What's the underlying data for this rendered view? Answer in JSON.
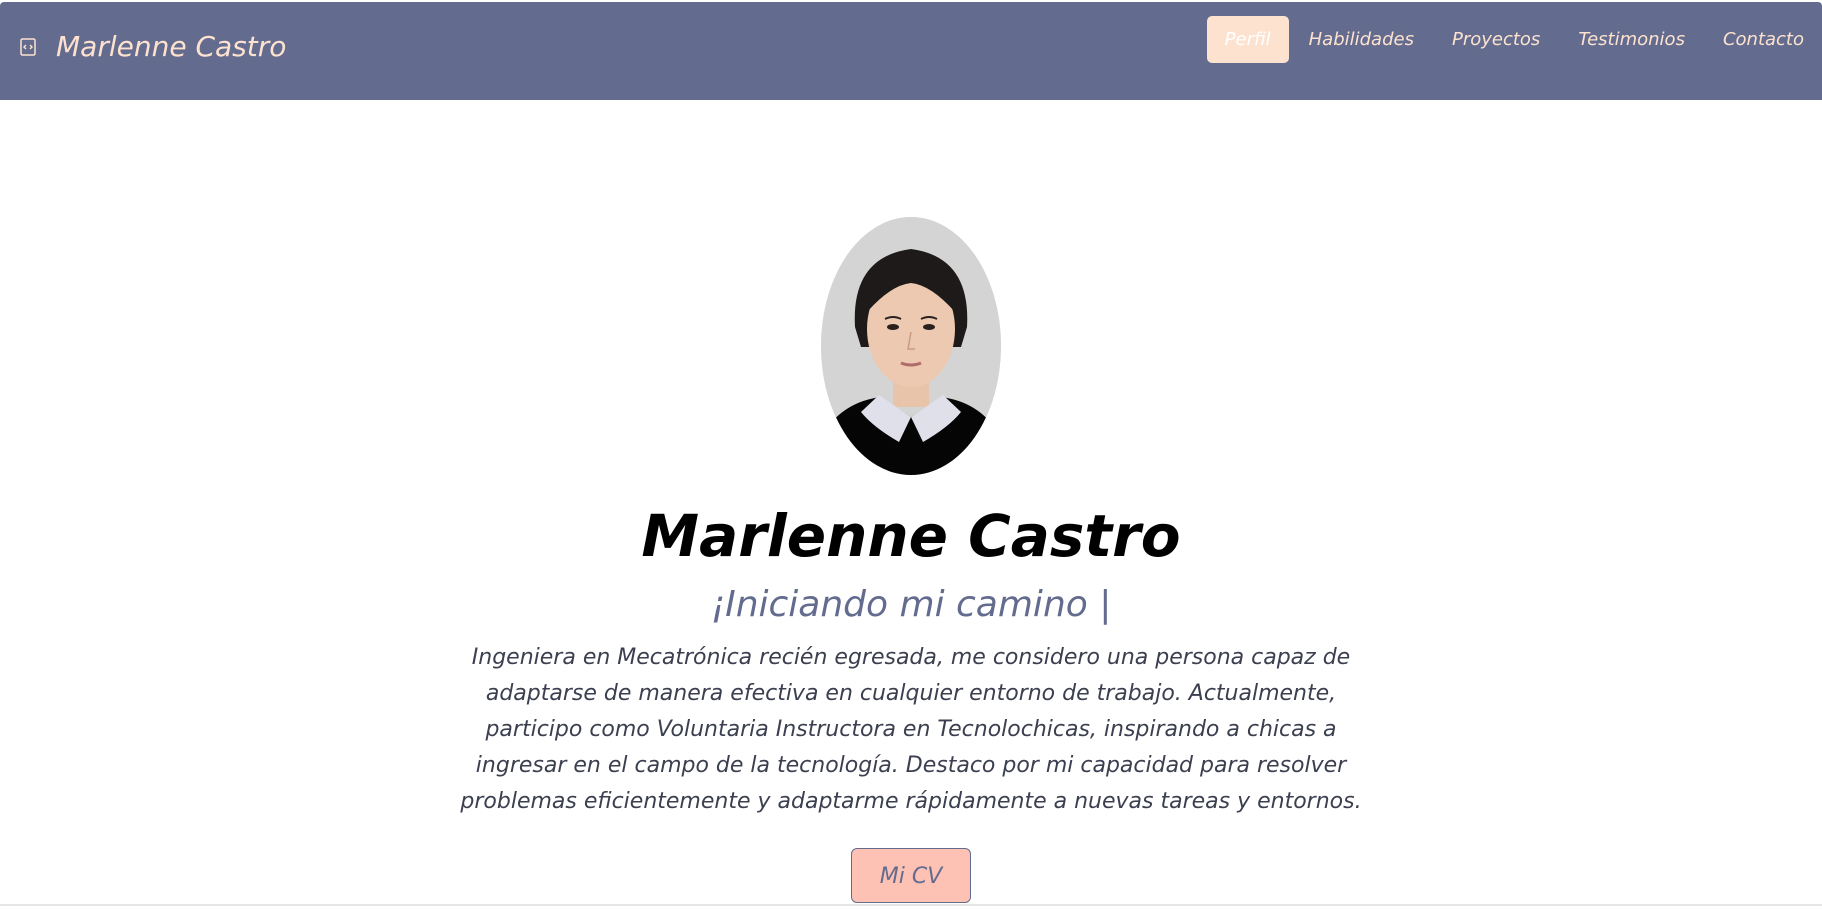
{
  "header": {
    "brand_name": "Marlenne Castro",
    "brand_icon": "code-file-icon",
    "nav_items": [
      "Perfil",
      "Habilidades",
      "Proyectos",
      "Testimonios",
      "Contacto"
    ],
    "active_nav": "Perfil"
  },
  "profile": {
    "name": "Marlenne Castro",
    "tagline": "¡Iniciando mi camino |",
    "bio": "Ingeniera en Mecatrónica recién egresada, me considero una persona capaz de adaptarse de manera efectiva en cualquier entorno de trabajo. Actualmente, participo como Voluntaria Instructora en Tecnolochicas, inspirando a chicas a ingresar en el campo de la tecnología. Destaco por mi capacidad para resolver problemas eficientemente y adaptarme rápidamente a nuevas tareas y entornos.",
    "cv_button": "Mi CV"
  },
  "colors": {
    "navbar": "#636b8e",
    "accent": "#fde2d0",
    "button": "#fec2b5"
  }
}
